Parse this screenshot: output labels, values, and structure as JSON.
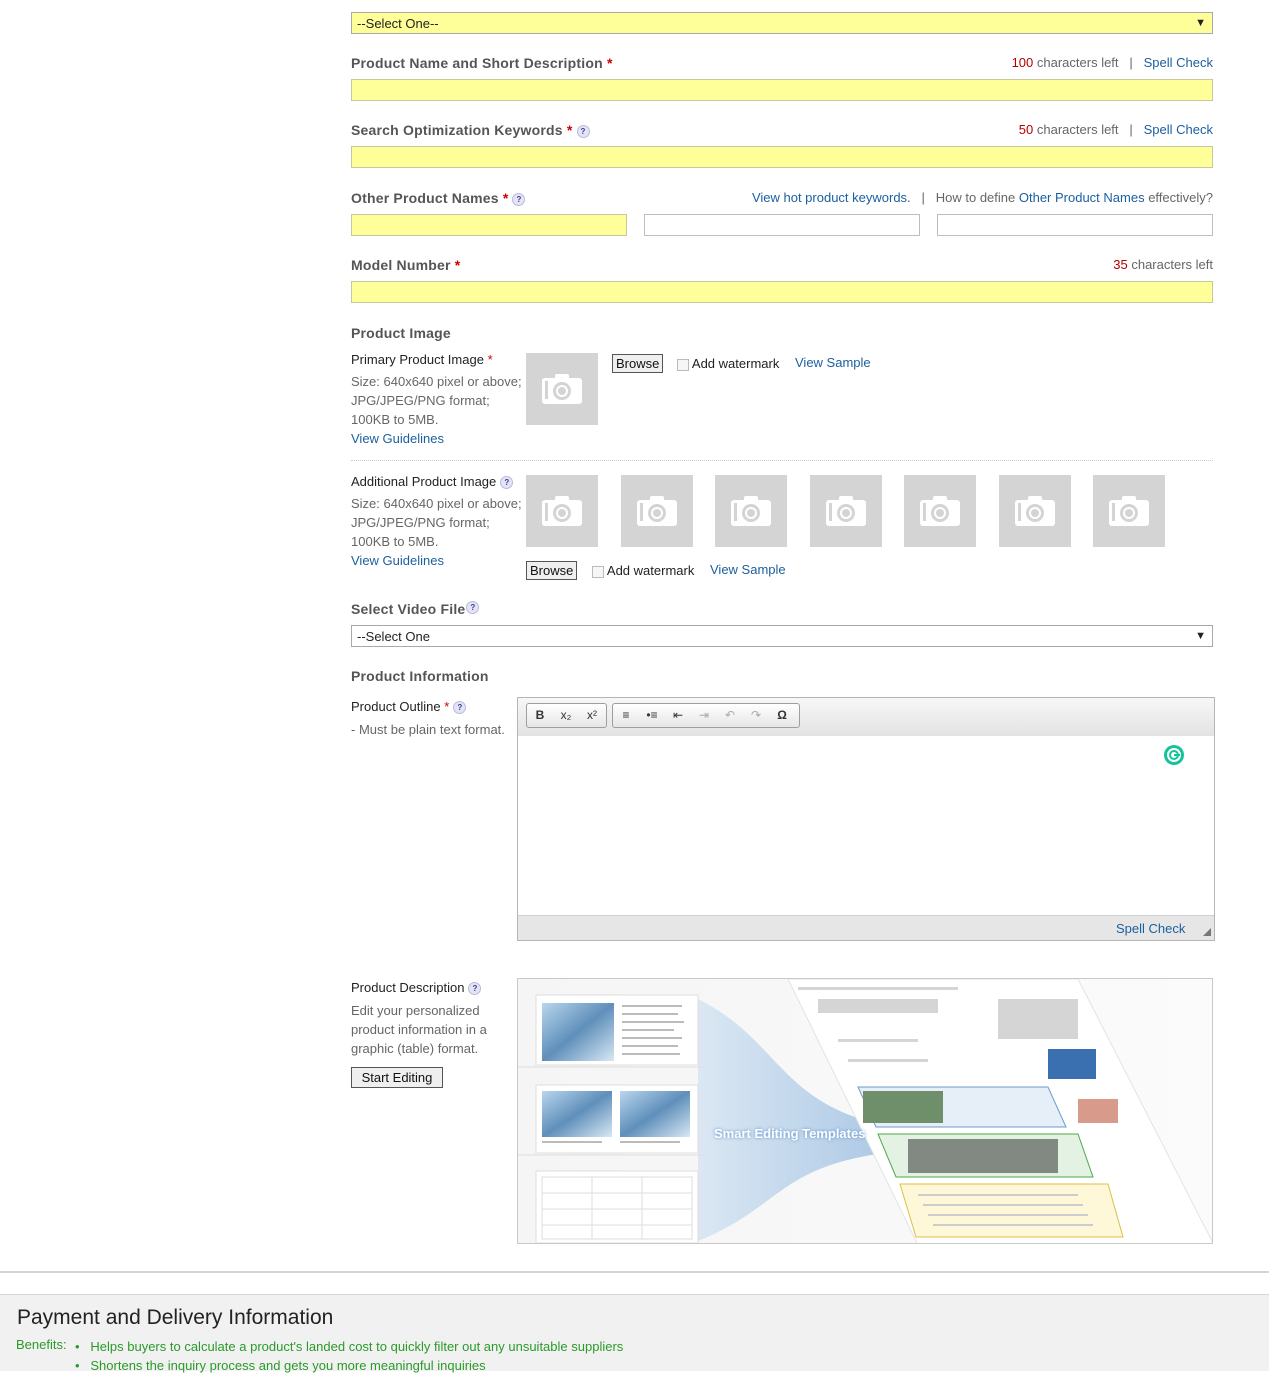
{
  "category": {
    "select_value": "--Select One--"
  },
  "product_name": {
    "label": "Product Name and Short Description",
    "required": "*",
    "chars_left": "100",
    "chars_left_suffix": "characters left",
    "separator": "|",
    "spell_check": "Spell Check"
  },
  "keywords": {
    "label": "Search Optimization Keywords",
    "required": "*",
    "chars_left": "50",
    "chars_left_suffix": "characters left",
    "separator": "|",
    "spell_check": "Spell Check"
  },
  "other_names": {
    "label": "Other Product Names",
    "required": "*",
    "hot_link": "View hot product keywords.",
    "separator": "|",
    "how_prefix": "How to define ",
    "how_link": "Other Product Names",
    "how_suffix": " effectively?"
  },
  "model_number": {
    "label": "Model Number",
    "required": "*",
    "chars_left": "35",
    "chars_left_suffix": "characters left"
  },
  "product_image": {
    "heading": "Product Image",
    "primary": {
      "label": "Primary Product Image",
      "required": "*",
      "size": "Size: 640x640 pixel or above;",
      "format": "JPG/JPEG/PNG format;",
      "range": "100KB to 5MB.",
      "guidelines": "View Guidelines",
      "browse": "Browse",
      "watermark": "Add watermark",
      "sample": "View Sample"
    },
    "additional": {
      "label": "Additional Product Image",
      "size": "Size: 640x640 pixel or above;",
      "format": "JPG/JPEG/PNG format;",
      "range": "100KB to 5MB.",
      "guidelines": "View Guidelines",
      "browse": "Browse",
      "watermark": "Add watermark",
      "sample": "View Sample",
      "slots": 7
    }
  },
  "video": {
    "label": "Select Video File",
    "select_value": "--Select One"
  },
  "product_info": {
    "heading": "Product Information",
    "outline": {
      "label": "Product Outline",
      "required": "*",
      "note": "- Must be plain text format.",
      "spell_check": "Spell Check"
    },
    "toolbar": {
      "bold": "B",
      "subscript": "x₂",
      "superscript": "x²",
      "special_char": "Ω"
    },
    "description": {
      "label": "Product Description",
      "text1": "Edit your personalized",
      "text2": "product information in a",
      "text3": "graphic (table) format.",
      "button": "Start Editing",
      "banner_text": "Smart Editing Templates"
    }
  },
  "payment": {
    "title": "Payment and Delivery Information",
    "benefits_label": "Benefits:",
    "benefits": [
      "Helps buyers to calculate a product's landed cost to quickly filter out any unsuitable suppliers",
      "Shortens the inquiry process and gets you more meaningful inquiries"
    ]
  },
  "colors": {
    "required_field": "#ffff99",
    "link": "#1b5f9e",
    "benefit_text": "#2a9a2a",
    "footer_bg": "#f1f1f1"
  }
}
